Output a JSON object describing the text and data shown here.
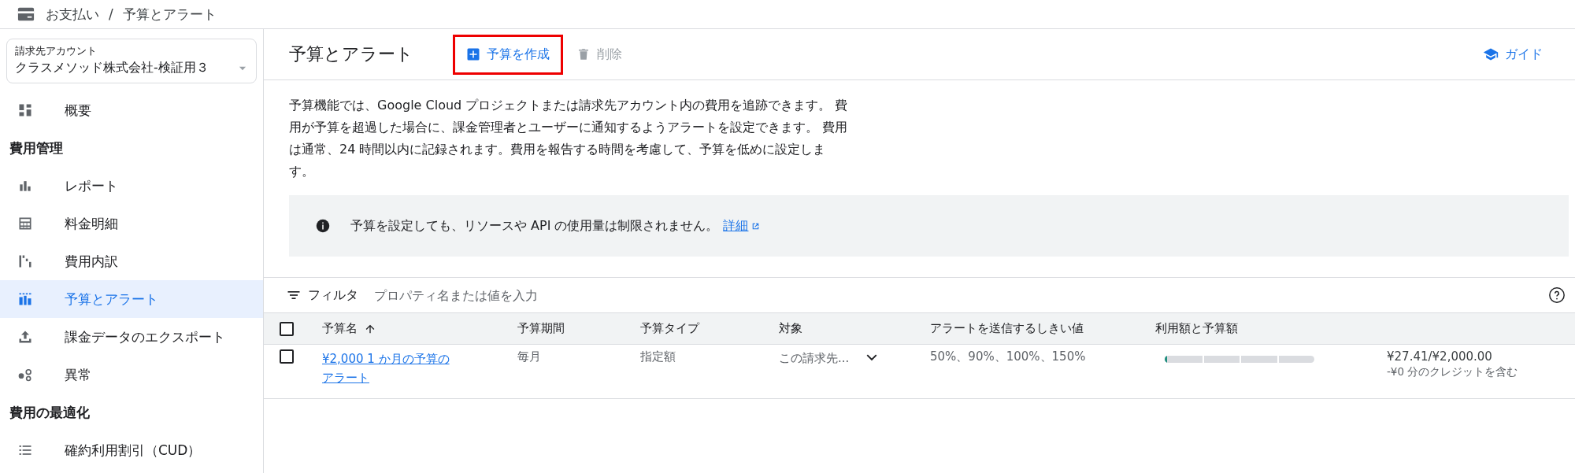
{
  "breadcrumb": {
    "items": [
      "お支払い",
      "/",
      "予算とアラート"
    ]
  },
  "sidebar": {
    "account": {
      "label": "請求先アカウント",
      "value": "クラスメソッド株式会社-検証用３"
    },
    "items": [
      {
        "kind": "item",
        "label": "概要",
        "selected": false
      },
      {
        "kind": "heading",
        "label": "費用管理"
      },
      {
        "kind": "item",
        "label": "レポート",
        "selected": false
      },
      {
        "kind": "item",
        "label": "料金明細",
        "selected": false
      },
      {
        "kind": "item",
        "label": "費用内訳",
        "selected": false
      },
      {
        "kind": "item",
        "label": "予算とアラート",
        "selected": true
      },
      {
        "kind": "item",
        "label": "課金データのエクスポート",
        "selected": false
      },
      {
        "kind": "item",
        "label": "異常",
        "selected": false
      },
      {
        "kind": "heading",
        "label": "費用の最適化"
      },
      {
        "kind": "item",
        "label": "確約利用割引（CUD）",
        "selected": false
      }
    ]
  },
  "toolbar": {
    "title": "予算とアラート",
    "create_button": {
      "label": "予算を作成",
      "highlighted": true
    },
    "delete_button": {
      "label": "削除",
      "disabled": true
    },
    "guide_button": {
      "label": "ガイド"
    }
  },
  "description": "予算機能では、Google Cloud プロジェクトまたは請求先アカウント内の費用を追跡できます。 費用が予算を超過した場合に、課金管理者とユーザーに通知するようアラートを設定できます。 費用は通常、24 時間以内に記録されます。費用を報告する時間を考慮して、予算を低めに設定します。",
  "info_banner": {
    "text": "予算を設定しても、リソースや API の使用量は制限されません。",
    "link": "詳細"
  },
  "filter": {
    "label": "フィルタ",
    "placeholder": "プロパティ名または値を入力"
  },
  "table": {
    "select_all": {
      "checked": false
    },
    "columns": [
      "予算名",
      "予算期間",
      "予算タイプ",
      "対象",
      "アラートを送信するしきい値",
      "利用額と予算額"
    ],
    "rows": [
      {
        "checked": false,
        "name": "¥2,000 1 か月の予算のアラート",
        "period": "毎月",
        "type": "指定額",
        "scope": "この請求先...",
        "thresholds": "50%、90%、100%、150%",
        "level": 0.014,
        "amount": "¥27.41/¥2,000.00",
        "credit": "-¥0 分のクレジットを含む"
      }
    ]
  }
}
